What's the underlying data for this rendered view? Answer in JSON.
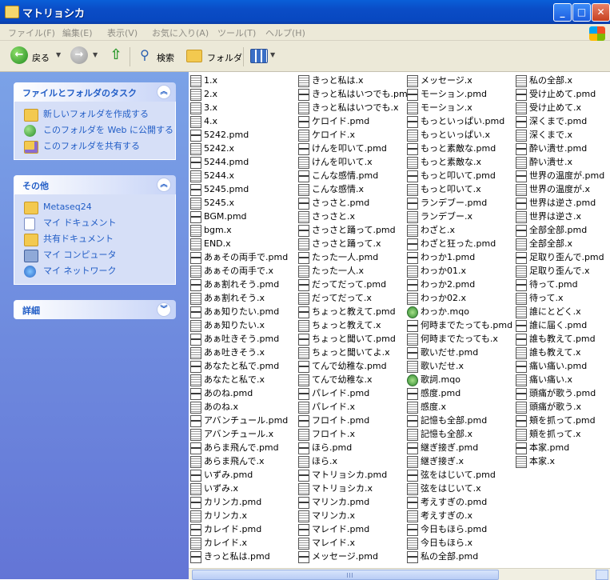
{
  "window": {
    "title": "マトリョシカ"
  },
  "menu": [
    "ファイル(F)",
    "編集(E)",
    "表示(V)",
    "お気に入り(A)",
    "ツール(T)",
    "ヘルプ(H)"
  ],
  "toolbar": {
    "back": "戻る",
    "search": "検索",
    "folders": "フォルダ"
  },
  "sidebar": {
    "tasks_title": "ファイルとフォルダのタスク",
    "tasks": [
      "新しいフォルダを作成する",
      "このフォルダを Web に公開する",
      "このフォルダを共有する"
    ],
    "other_title": "その他",
    "other": [
      "Metaseq24",
      "マイ ドキュメント",
      "共有ドキュメント",
      "マイ コンピュータ",
      "マイ ネットワーク"
    ],
    "details_title": "詳細"
  },
  "files": [
    [
      "1.x",
      "2.x",
      "3.x",
      "4.x",
      "5242.pmd",
      "5242.x",
      "5244.pmd",
      "5244.x",
      "5245.pmd",
      "5245.x",
      "BGM.pmd",
      "bgm.x",
      "END.x",
      "あぁその両手で.pmd",
      "あぁその両手で.x",
      "あぁ割れそう.pmd",
      "あぁ割れそう.x",
      "あぁ知りたい.pmd",
      "あぁ知りたい.x",
      "あぁ吐きそう.pmd",
      "あぁ吐きそう.x",
      "あなたと私で.pmd",
      "あなたと私で.x",
      "あのね.pmd",
      "あのね.x",
      "アバンチュール.pmd",
      "アバンチュール.x",
      "あらま飛んで.pmd",
      "あらま飛んで.x",
      "いずみ.pmd",
      "いずみ.x",
      "カリンカ.pmd",
      "カリンカ.x",
      "カレイド.pmd",
      "カレイド.x",
      "きっと私は.pmd"
    ],
    [
      "きっと私は.x",
      "きっと私はいつでも.pmd",
      "きっと私はいつでも.x",
      "ケロイド.pmd",
      "ケロイド.x",
      "けんを叩いて.pmd",
      "けんを叩いて.x",
      "こんな感情.pmd",
      "こんな感情.x",
      "さっさと.pmd",
      "さっさと.x",
      "さっさと踊って.pmd",
      "さっさと踊って.x",
      "たった一人.pmd",
      "たった一人.x",
      "だってだって.pmd",
      "だってだって.x",
      "ちょっと教えて.pmd",
      "ちょっと教えて.x",
      "ちょっと聞いて.pmd",
      "ちょっと聞いてよ.x",
      "てんで幼稚な.pmd",
      "てんで幼稚な.x",
      "パレイド.pmd",
      "パレイド.x",
      "フロイト.pmd",
      "フロイト.x",
      "ほら.pmd",
      "ほら.x",
      "マトリョシカ.pmd",
      "マトリョシカ.x",
      "マリンカ.pmd",
      "マリンカ.x",
      "マレイド.pmd",
      "マレイド.x",
      "メッセージ.pmd"
    ],
    [
      "メッセージ.x",
      "モーション.pmd",
      "モーション.x",
      "もっといっぱい.pmd",
      "もっといっぱい.x",
      "もっと素敵な.pmd",
      "もっと素敵な.x",
      "もっと叩いて.pmd",
      "もっと叩いて.x",
      "ランデブー.pmd",
      "ランデブー.x",
      "わざと.x",
      "わざと狂った.pmd",
      "わっか1.pmd",
      "わっか01.x",
      "わっか2.pmd",
      "わっか02.x",
      "わっか.mqo",
      "何時までたっても.pmd",
      "何時までたっても.x",
      "歌いだせ.pmd",
      "歌いだせ.x",
      "歌詞.mqo",
      "感度.pmd",
      "感度.x",
      "記憶も全部.pmd",
      "記憶も全部.x",
      "継ぎ接ぎ.pmd",
      "継ぎ接ぎ.x",
      "弦をはじいて.pmd",
      "弦をはじいて.x",
      "考えすぎの.pmd",
      "考えすぎの.x",
      "今日もほら.pmd",
      "今日もほら.x",
      "私の全部.pmd"
    ],
    [
      "私の全部.x",
      "受け止めて.pmd",
      "受け止めて.x",
      "深くまで.pmd",
      "深くまで.x",
      "酔い潰せ.pmd",
      "酔い潰せ.x",
      "世界の温度が.pmd",
      "世界の温度が.x",
      "世界は逆さ.pmd",
      "世界は逆さ.x",
      "全部全部.pmd",
      "全部全部.x",
      "足取り歪んで.pmd",
      "足取り歪んで.x",
      "待って.pmd",
      "待って.x",
      "誰にとどく.x",
      "誰に届く.pmd",
      "誰も教えて.pmd",
      "誰も教えて.x",
      "痛い痛い.pmd",
      "痛い痛い.x",
      "頭痛が歌う.pmd",
      "頭痛が歌う.x",
      "頬を抓って.pmd",
      "頬を抓って.x",
      "本家.pmd",
      "本家.x"
    ]
  ]
}
